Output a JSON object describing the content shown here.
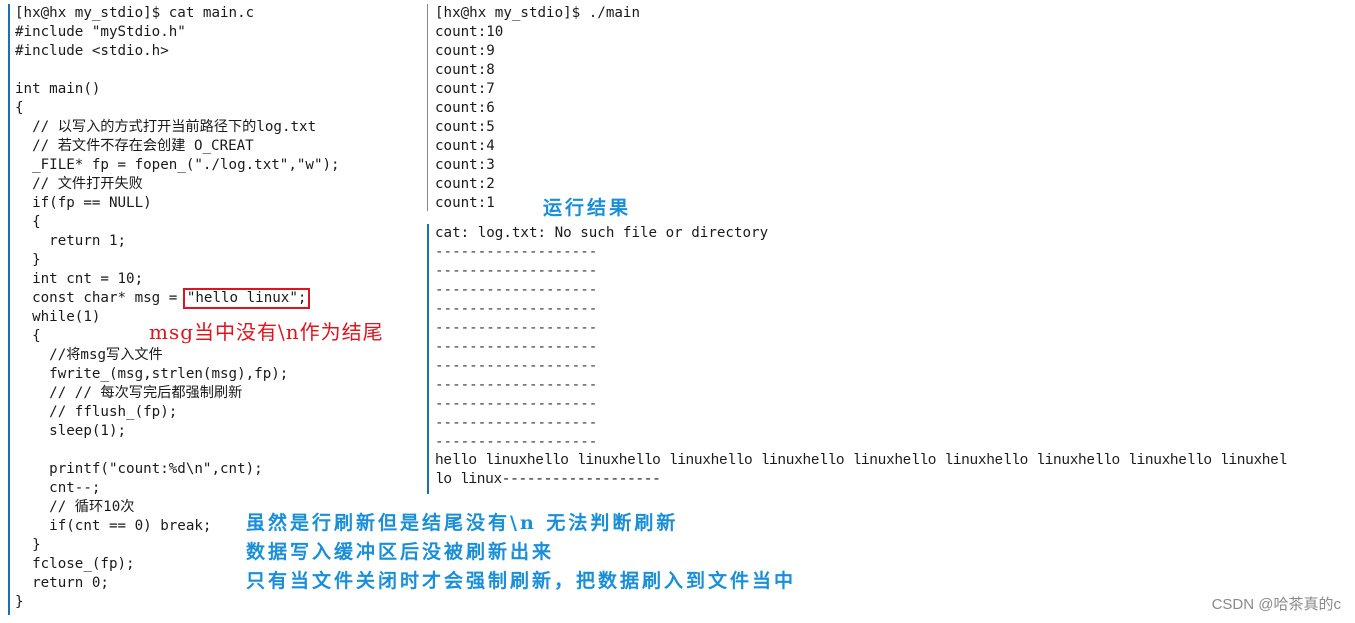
{
  "code_panel": {
    "prompt": "[hx@hx my_stdio]$ cat main.c",
    "lines": [
      "#include \"myStdio.h\"",
      "#include <stdio.h>",
      "",
      "int main()",
      "{",
      "  // 以写入的方式打开当前路径下的log.txt",
      "  // 若文件不存在会创建 O_CREAT",
      "  _FILE* fp = fopen_(\"./log.txt\",\"w\");",
      "  // 文件打开失败",
      "  if(fp == NULL)",
      "  {",
      "    return 1;",
      "  }",
      "  int cnt = 10;"
    ],
    "msg_line_prefix": "  const char* msg = ",
    "msg_highlighted": "\"hello linux\";",
    "lines_after": [
      "  while(1)",
      "  {",
      "    //将msg写入文件",
      "    fwrite_(msg,strlen(msg),fp);",
      "    // // 每次写完后都强制刷新",
      "    // fflush_(fp);",
      "    sleep(1);",
      "",
      "    printf(\"count:%d\\n\",cnt);",
      "    cnt--;",
      "    // 循环10次",
      "    if(cnt == 0) break;",
      "  }",
      "  fclose_(fp);",
      "  return 0;",
      "}"
    ]
  },
  "run_panel": {
    "prompt": "[hx@hx my_stdio]$ ./main",
    "output": [
      "count:10",
      "count:9",
      "count:8",
      "count:7",
      "count:6",
      "count:5",
      "count:4",
      "count:3",
      "count:2",
      "count:1"
    ]
  },
  "cat_panel": {
    "error": "cat: log.txt: No such file or directory",
    "dash_lines": [
      "-------------------",
      "-------------------",
      "-------------------",
      "-------------------",
      "-------------------",
      "-------------------",
      "-------------------",
      "-------------------",
      "-------------------",
      "-------------------",
      "-------------------"
    ],
    "file_content_line1": "hello linuxhello linuxhello linuxhello linuxhello linuxhello linuxhello linuxhello linuxhello linuxhel",
    "file_content_line2": "lo linux-------------------"
  },
  "annotations": {
    "msg_note": "msg当中没有\\n作为结尾",
    "run_result": "运行结果",
    "explain_1": "虽然是行刷新但是结尾没有\\n 无法判断刷新",
    "explain_2": "数据写入缓冲区后没被刷新出来",
    "explain_3": "只有当文件关闭时才会强制刷新，把数据刷入到文件当中"
  },
  "colors": {
    "annotation_red": "#e0141e",
    "annotation_blue": "#1a8fd8",
    "panel_bar_blue": "#1f6fb8"
  },
  "watermark": "CSDN @哈茶真的c"
}
